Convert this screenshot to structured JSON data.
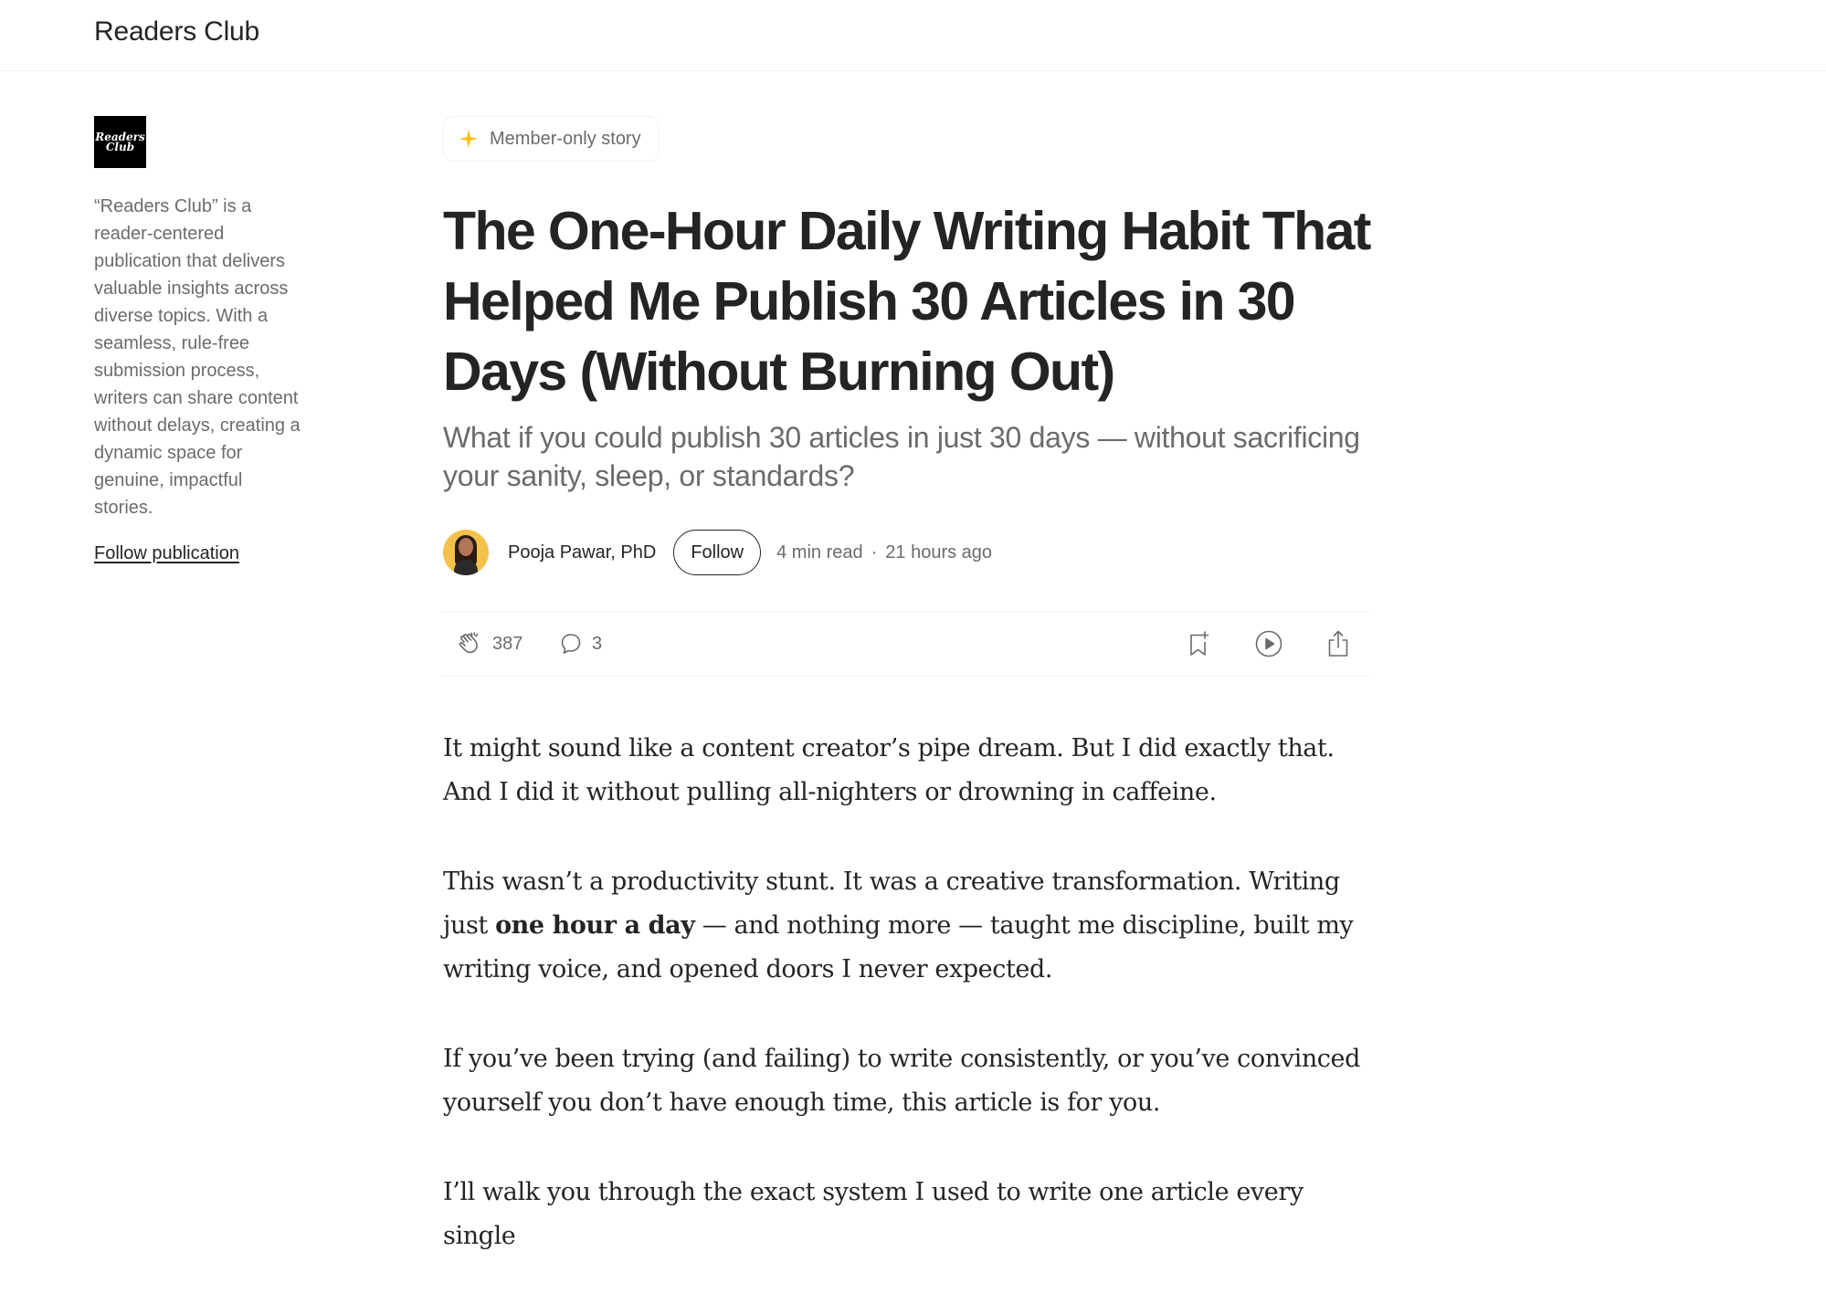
{
  "publication": {
    "name": "Readers Club",
    "logo_line1": "Readers",
    "logo_line2": "Club",
    "description": "“Readers Club” is a reader-centered publication that delivers valuable insights across diverse topics. With a seamless, rule-free submission process, writers can share content without delays, creating a dynamic space for genuine, impactful stories.",
    "follow_label": "Follow publication"
  },
  "article": {
    "badge": "Member-only story",
    "title": "The One-Hour Daily Writing Habit That Helped Me Publish 30 Articles in 30 Days (Without Burning Out)",
    "subtitle": "What if you could publish 30 articles in just 30 days — without sacrificing your sanity, sleep, or standards?",
    "author": "Pooja Pawar, PhD",
    "follow_label": "Follow",
    "read_time": "4 min read",
    "separator": "·",
    "published": "21 hours ago",
    "claps": "387",
    "responses": "3",
    "paragraphs": {
      "p1": "It might sound like a content creator’s pipe dream. But I did exactly that. And I did it without pulling all-nighters or drowning in caffeine.",
      "p2_before": "This wasn’t a productivity stunt. It was a creative transformation. Writing just ",
      "p2_bold": "one hour a day",
      "p2_after": " — and nothing more — taught me discipline, built my writing voice, and opened doors I never expected.",
      "p3": "If you’ve been trying (and failing) to write consistently, or you’ve convinced yourself you don’t have enough time, this article is for you.",
      "p4": "I’ll walk you through the exact system I used to write one article every single"
    }
  },
  "icons": {
    "badge": "sparkle-star-icon",
    "claps": "clap-icon",
    "responses": "speech-bubble-icon",
    "save": "bookmark-add-icon",
    "listen": "play-circle-icon",
    "share": "share-icon"
  },
  "colors": {
    "accent_star": "#FFC017",
    "text_primary": "#242424",
    "text_secondary": "#6B6B6B",
    "avatar_bg": "#F4C24A"
  }
}
